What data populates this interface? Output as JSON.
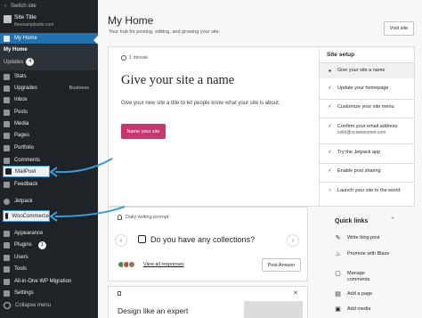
{
  "sidebar": {
    "switch_site": "Switch site",
    "site_title": "Site Title",
    "site_url": "theexamplesite.com",
    "my_home": "My Home",
    "sub_my_home": "My Home",
    "sub_updates": "Updates",
    "updates_count": "4",
    "items": [
      {
        "label": "Stats",
        "icon": "stats-icon"
      },
      {
        "label": "Upgrades",
        "right": "Business",
        "icon": "upgrades-icon"
      },
      {
        "label": "Inbox",
        "icon": "inbox-icon"
      },
      {
        "label": "Posts",
        "icon": "posts-icon"
      },
      {
        "label": "Media",
        "icon": "media-icon"
      },
      {
        "label": "Pages",
        "icon": "pages-icon"
      },
      {
        "label": "Portfolio",
        "icon": "portfolio-icon"
      },
      {
        "label": "Comments",
        "icon": "comments-icon"
      },
      {
        "label": "MailPoet",
        "icon": "mailpoet-icon"
      },
      {
        "label": "Feedback",
        "icon": "feedback-icon"
      },
      {
        "label": "Jetpack",
        "icon": "jetpack-icon"
      },
      {
        "label": "WooCommerce",
        "icon": "woocommerce-icon"
      },
      {
        "label": "Appearance",
        "icon": "appearance-icon"
      },
      {
        "label": "Plugins",
        "icon": "plugins-icon",
        "badge": "1"
      },
      {
        "label": "Users",
        "icon": "users-icon"
      },
      {
        "label": "Tools",
        "icon": "tools-icon"
      },
      {
        "label": "All-in-One WP Migration",
        "icon": "migration-icon"
      },
      {
        "label": "Settings",
        "icon": "settings-icon"
      }
    ],
    "collapse": "Collapse menu",
    "highlight_color": "#3a9bdc",
    "active_color": "#2271b1"
  },
  "header": {
    "title": "My Home",
    "subtitle": "Your hub for posting, editing, and growing your site.",
    "visit_site": "Visit site"
  },
  "task": {
    "time": "1 minute",
    "title": "Give your site a name",
    "description": "Give your new site a title to let people know what your site is about.",
    "button": "Name your site",
    "button_color": "#c9356e"
  },
  "setup": {
    "heading": "Site setup",
    "items": [
      {
        "text": "Give your site a name",
        "state": "current"
      },
      {
        "text": "Update your homepage",
        "state": "done"
      },
      {
        "text": "Customize your site menu",
        "state": "done"
      },
      {
        "text": "Confirm your email address",
        "sub": "colin@ncnewcomer.com",
        "state": "done"
      },
      {
        "text": "Try the Jetpack app",
        "state": "done"
      },
      {
        "text": "Enable post sharing",
        "state": "done"
      },
      {
        "text": "Launch your site to the world",
        "state": "todo"
      }
    ]
  },
  "prompt": {
    "heading": "Daily writing prompt",
    "question": "Do you have any collections?",
    "view_all": "View all responses",
    "post_answer": "Post Answer"
  },
  "lesson": {
    "title": "Design like an expert"
  },
  "quick_links": {
    "heading": "Quick links",
    "items": [
      {
        "text": "Write blog post",
        "icon": "pencil-icon"
      },
      {
        "text": "Promote with Blaze",
        "icon": "blaze-icon"
      },
      {
        "text": "Manage comments",
        "icon": "comments-icon"
      },
      {
        "text": "Add a page",
        "icon": "add-page-icon"
      },
      {
        "text": "Add media",
        "icon": "media-icon"
      }
    ]
  }
}
